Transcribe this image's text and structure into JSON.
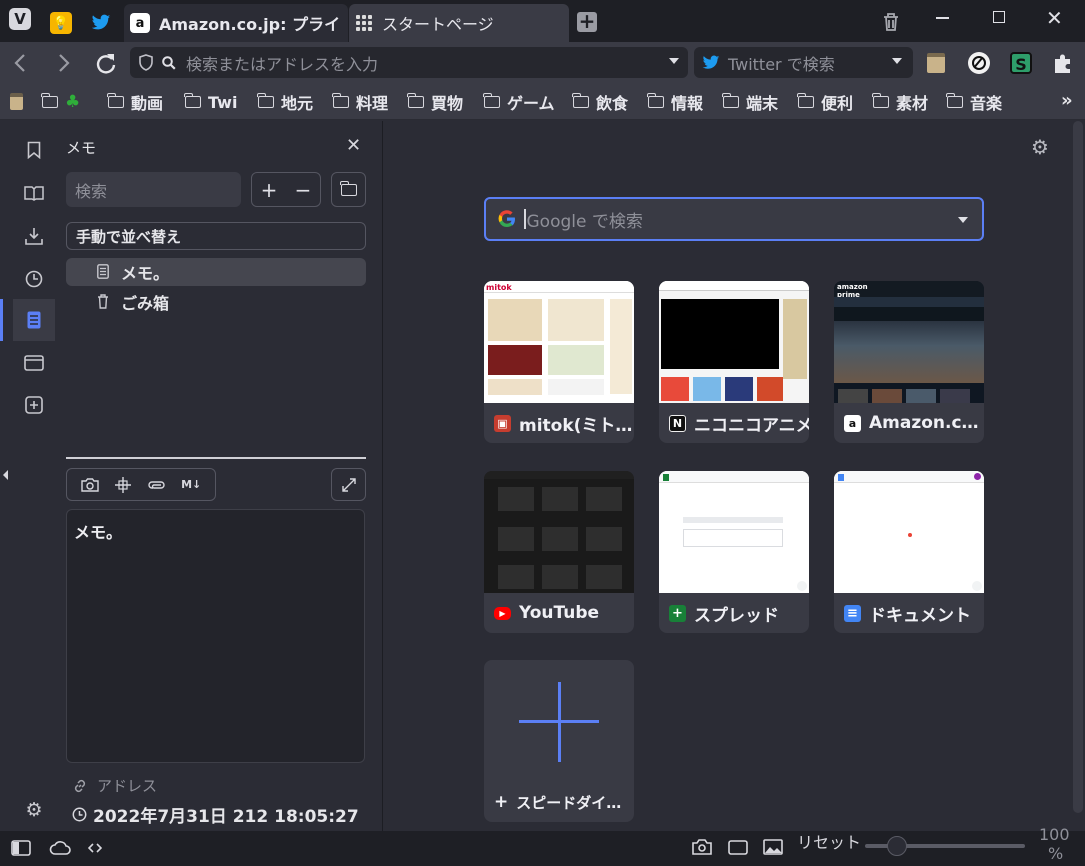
{
  "tabs": [
    {
      "title": "",
      "icon": "keep-icon"
    },
    {
      "title": "",
      "icon": "twitter-icon"
    },
    {
      "title": "Amazon.co.jp: プライ",
      "icon": "amazon-icon"
    },
    {
      "title": "スタートページ",
      "icon": "grid-icon"
    }
  ],
  "address": {
    "placeholder": "検索またはアドレスを入力",
    "search_engine": "Twitter で検索"
  },
  "bookmarks": [
    "",
    "動画",
    "Twi",
    "地元",
    "料理",
    "買物",
    "ゲーム",
    "飲食",
    "情報",
    "端末",
    "便利",
    "素材",
    "音楽"
  ],
  "notes": {
    "title": "メモ",
    "search_placeholder": "検索",
    "sort_label": "手動で並べ替え",
    "items": [
      {
        "label": "メモ。",
        "icon": "note-icon"
      },
      {
        "label": "ごみ箱",
        "icon": "trash-icon"
      }
    ],
    "toolbar_md": "M↓",
    "editor_text": "メモ。",
    "url_label": "アドレス",
    "date": "2022年7月31日 212 18:05:27"
  },
  "startpage": {
    "search_placeholder": "Google で検索",
    "speed_dials": [
      {
        "label": "mitok(ミト…"
      },
      {
        "label": "ニコニコアニメ"
      },
      {
        "label": "Amazon.c…"
      },
      {
        "label": "YouTube"
      },
      {
        "label": "スプレッド"
      },
      {
        "label": "ドキュメント"
      }
    ],
    "add_label": "スピードダイ…"
  },
  "status": {
    "reset_label": "リセット",
    "zoom": "100",
    "zoom_unit": "%"
  },
  "colors": {
    "accent": "#5b7ff5",
    "titlebar": "#1e1f25",
    "toolbar": "#3a3b45",
    "background": "#2b2c35"
  }
}
